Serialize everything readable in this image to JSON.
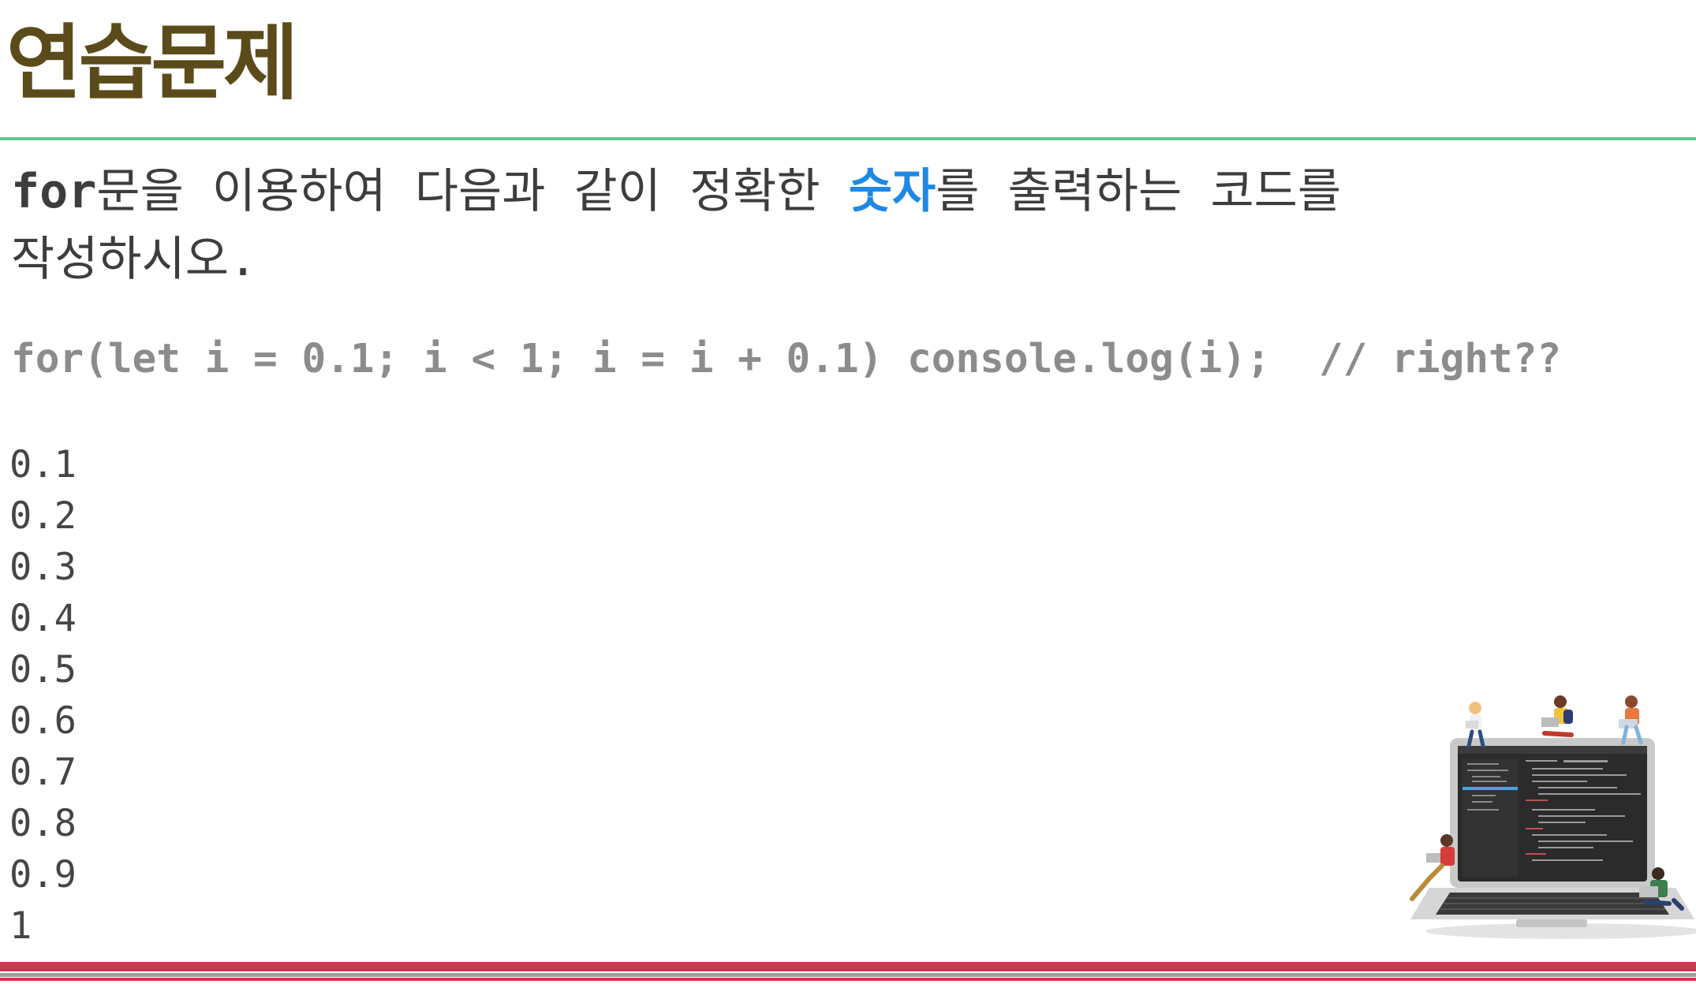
{
  "title": "연습문제",
  "instruction": {
    "keyword": "for",
    "part1": "문을 이용하여 다음과 같이 정확한 ",
    "highlight": "숫자",
    "part2": "를 출력하는 코드를",
    "line2": "작성하시오."
  },
  "code_line": "for(let i = 0.1; i < 1; i = i + 0.1) console.log(i);  // right??",
  "output_lines": [
    "0.1",
    "0.2",
    "0.3",
    "0.4",
    "0.5",
    "0.6",
    "0.7",
    "0.8",
    "0.9",
    "1"
  ],
  "colors": {
    "title": "#5b4b1a",
    "accent_green": "#66c596",
    "highlight_blue": "#1e88e5",
    "band_red": "#d0344f",
    "band_grey": "#9aa39a"
  },
  "illustration_icon": "laptop-with-people-illustration"
}
